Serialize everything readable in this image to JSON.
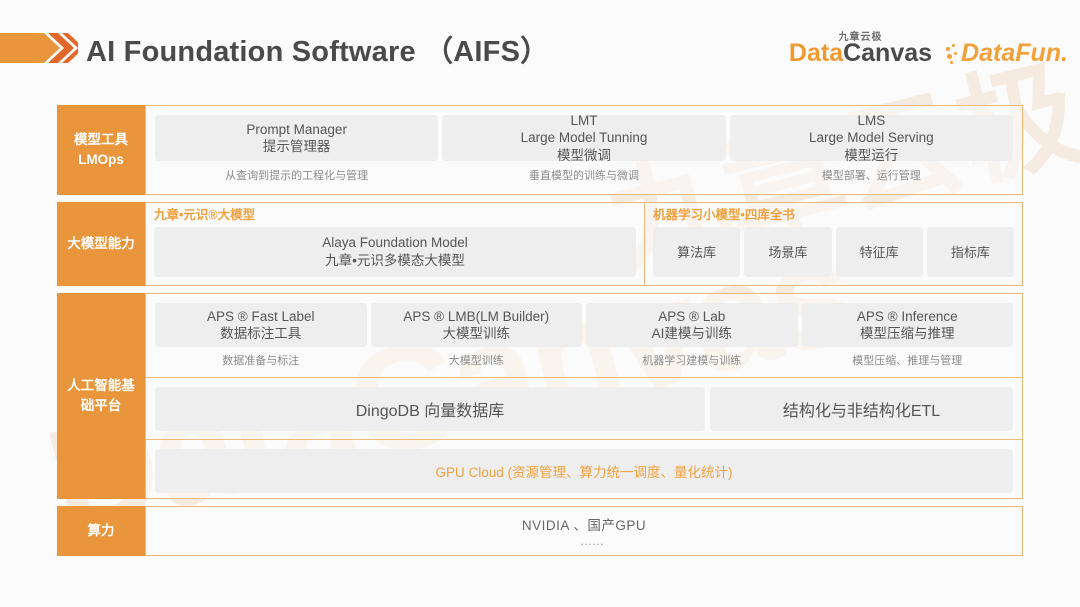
{
  "header": {
    "title": "AI Foundation Software （AIFS）",
    "logos": {
      "datacanvas_cn": "九章云极",
      "datacanvas_data": "Data",
      "datacanvas_canvas": "Canvas",
      "datafun": "DataFun."
    }
  },
  "accent_colors": {
    "orange": "#e8953c",
    "orange_text": "#f0a13f",
    "border": "#edb97c",
    "card_bg": "#eeeeee",
    "title_gray": "#4a4a4a",
    "sub_gray": "#8b8b8b",
    "page_bg": "#fbfbfb"
  },
  "watermark": {
    "text1": "DataCanvas",
    "text2": "九章云极"
  },
  "rows": [
    {
      "label_line1": "模型工具",
      "label_line2": "LMOps",
      "cards": [
        {
          "en": "Prompt Manager",
          "cn": "提示管理器",
          "sub": "从查询到提示的工程化与管理"
        },
        {
          "en": "LMT",
          "en2": "Large Model Tunning",
          "cn": "模型微调",
          "sub": "垂直模型的训练与微调"
        },
        {
          "en": "LMS",
          "en2": "Large Model Serving",
          "cn": "模型运行",
          "sub": "模型部署、运行管理"
        }
      ]
    },
    {
      "label_line1": "大模型能力",
      "left_panel_title": "九章•元识®大模型",
      "left_card": {
        "en": "Alaya Foundation Model",
        "cn": "九章•元识多模态大模型"
      },
      "right_panel_title": "机器学习小模型•四库全书",
      "right_cards": [
        "算法库",
        "场景库",
        "特征库",
        "指标库"
      ]
    },
    {
      "label_line1": "人工智能基",
      "label_line2": "础平台",
      "aps_cards": [
        {
          "en": "APS ® Fast Label",
          "cn": "数据标注工具",
          "sub": "数据准备与标注"
        },
        {
          "en": "APS ® LMB(LM Builder)",
          "cn": "大模型训练",
          "sub": "大模型训练"
        },
        {
          "en": "APS ® Lab",
          "cn": "AI建模与训练",
          "sub": "机器学习建模与训练"
        },
        {
          "en": "APS ® Inference",
          "cn": "模型压缩与推理",
          "sub": "模型压缩、推理与管理"
        }
      ],
      "data_cards": [
        "DingoDB 向量数据库",
        "结构化与非结构化ETL"
      ],
      "gpu_card": "GPU Cloud (资源管理、算力统一调度、量化统计)"
    },
    {
      "label_line1": "算力",
      "text": "NVIDIA 、国产GPU",
      "dots": "……"
    }
  ]
}
